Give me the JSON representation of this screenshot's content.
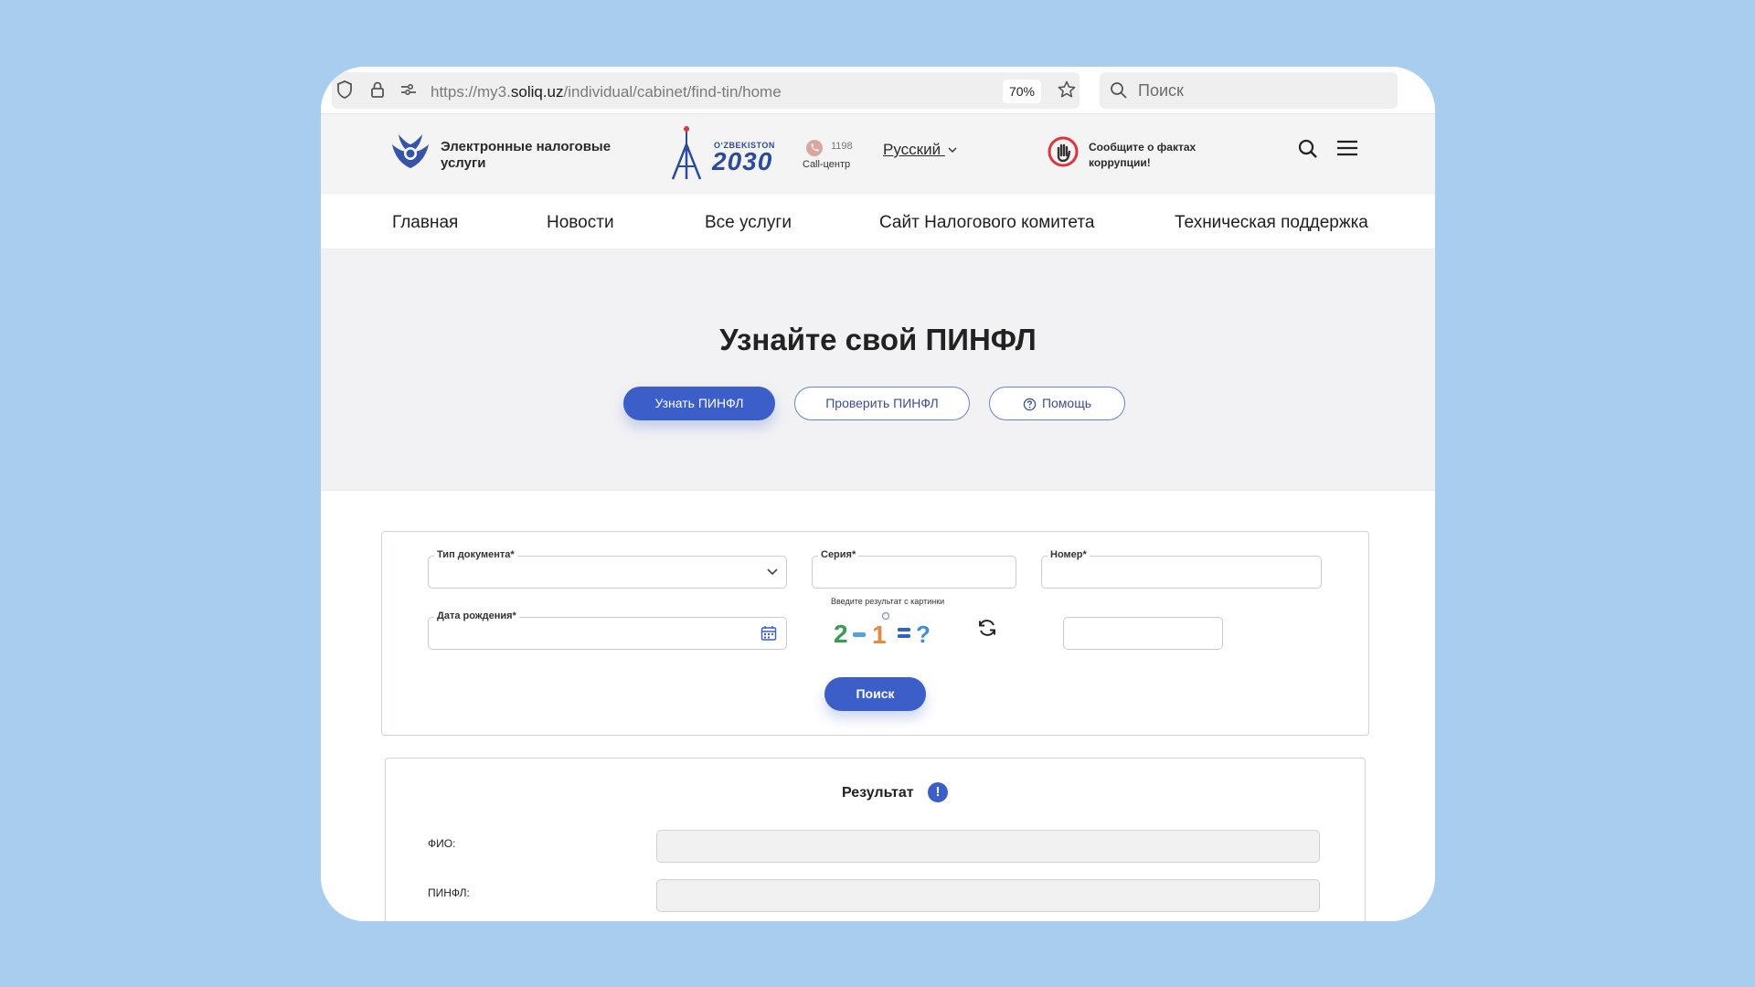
{
  "browser": {
    "url_scheme": "https://my3.",
    "url_host": "soliq.uz",
    "url_path": "/individual/cabinet/find-tin/home",
    "zoom": "70%",
    "search_placeholder": "Поиск"
  },
  "header": {
    "logo_text": "Электронные налоговые услуги",
    "uz2030_small": "OʻZBEKISTON",
    "uz2030_big": "2030",
    "call_number": "1198",
    "call_label": "Call-центр",
    "language": "Русский",
    "corruption_text": "Сообщите о фактах коррупции!"
  },
  "nav": {
    "items": [
      "Главная",
      "Новости",
      "Все услуги",
      "Сайт Налогового комитета",
      "Техническая поддержка"
    ]
  },
  "hero": {
    "title": "Узнайте свой ПИНФЛ",
    "btn_find": "Узнать ПИНФЛ",
    "btn_check": "Проверить ПИНФЛ",
    "btn_help": "Помощь"
  },
  "form": {
    "doc_type_label": "Тип документа*",
    "series_label": "Серия*",
    "number_label": "Номер*",
    "birth_label": "Дата рождения*",
    "captcha_hint": "Введите результат с картинки",
    "captcha_glyphs": "2 − 1 = ?",
    "search_button": "Поиск"
  },
  "result": {
    "title": "Результат",
    "info_icon": "!",
    "fio_label": "ФИО:",
    "pinfl_label": "ПИНФЛ:"
  },
  "colors": {
    "background": "#a9cdee",
    "primary": "#3b5ec9"
  }
}
